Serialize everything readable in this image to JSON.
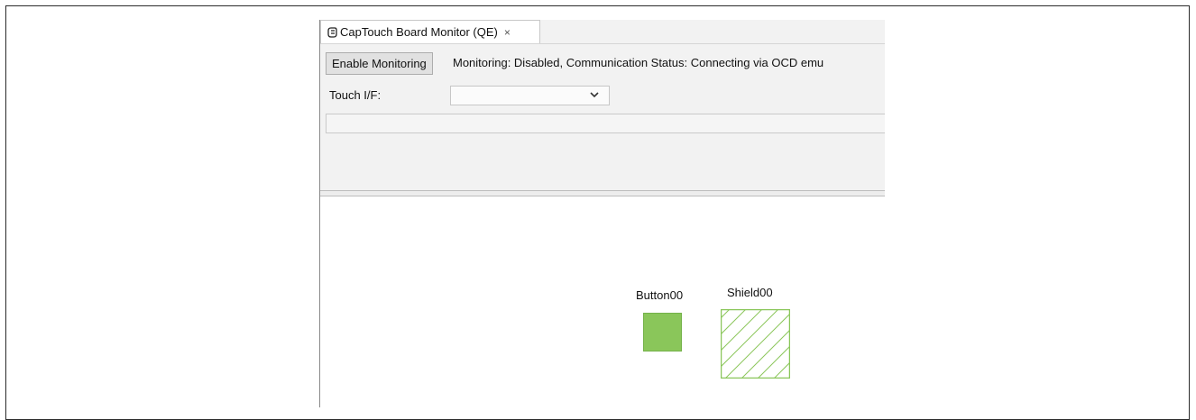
{
  "panel": {
    "tab_title": "CapTouch Board Monitor (QE)",
    "tab_close": "×"
  },
  "toolbar": {
    "enable_button_label": "Enable Monitoring",
    "status_text": "Monitoring: Disabled, Communication Status: Connecting via OCD emu"
  },
  "touch_if": {
    "label": "Touch I/F:",
    "selected_value": ""
  },
  "canvas": {
    "elements": [
      {
        "name": "Button00",
        "kind": "button",
        "color": "#8ac65a"
      },
      {
        "name": "Shield00",
        "kind": "shield",
        "color": "#8ac65a"
      }
    ]
  },
  "icons": {
    "tab_icon": "touch-hand-icon",
    "dropdown": "chevron-down-icon"
  }
}
